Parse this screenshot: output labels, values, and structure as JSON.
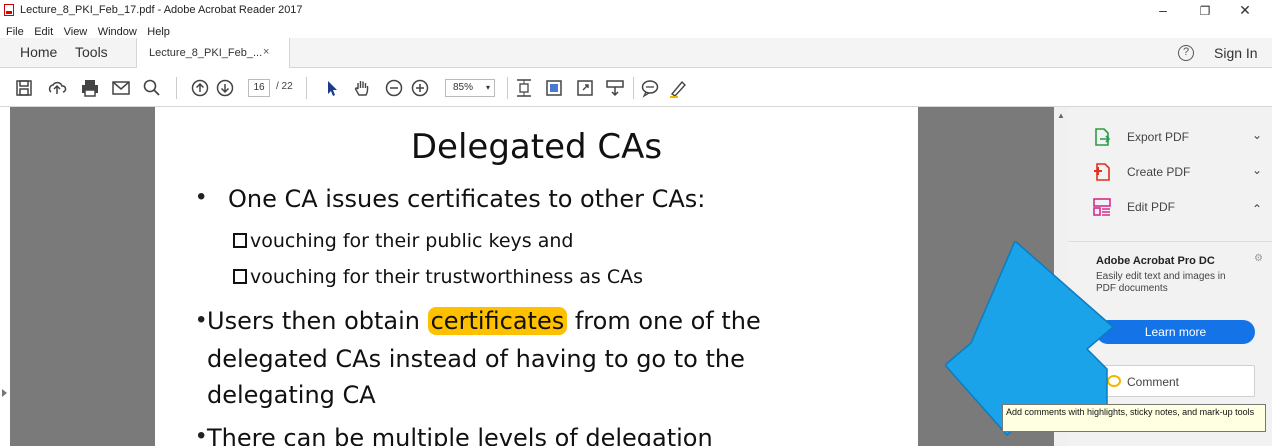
{
  "window": {
    "title": "Lecture_8_PKI_Feb_17.pdf - Adobe Acrobat Reader 2017",
    "minimize": "–",
    "maximize": "❐",
    "close": "✕"
  },
  "menu": [
    "File",
    "Edit",
    "View",
    "Window",
    "Help"
  ],
  "tabs": {
    "home": "Home",
    "tools": "Tools",
    "document": "Lecture_8_PKI_Feb_...",
    "close": "×",
    "help": "?",
    "signin": "Sign In"
  },
  "toolbar": {
    "page_current": "16",
    "page_total": "/ 22",
    "zoom": "85%",
    "zoom_caret": "▾"
  },
  "slide": {
    "title": "Delegated CAs",
    "bullet1": "One CA issues certificates to other CAs:",
    "sub1": "vouching for their public keys and",
    "sub2": "vouching for their trustworthiness as CAs",
    "bullet2_pre": "Users then obtain ",
    "bullet2_hl": "certificates",
    "bullet2_post": " from one of the",
    "bullet2_line2": "delegated CAs instead of having to go to the",
    "bullet2_line3": "delegating CA",
    "bullet3": "There can be multiple levels of delegation",
    "bullet_char": "•"
  },
  "panel": {
    "export": "Export PDF",
    "create": "Create PDF",
    "edit": "Edit PDF",
    "chev_down": "⌄",
    "chev_up": "⌃",
    "promo_title": "Adobe Acrobat Pro DC",
    "promo_text": "Easily edit text and images in PDF documents",
    "learn_more": "Learn more",
    "comment": "Comment"
  },
  "tooltip": "Add comments with highlights, sticky notes, and mark-up tools",
  "colors": {
    "accent": "#1473e6",
    "highlight": "#ffc000",
    "arrow": "#1aa3e8"
  }
}
